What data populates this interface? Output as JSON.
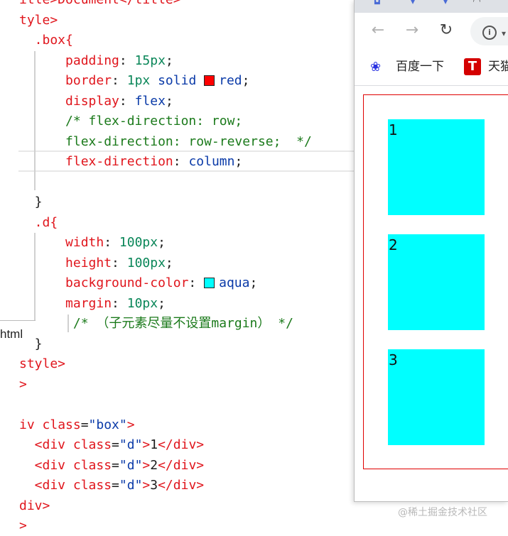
{
  "editor": {
    "lines": [
      {
        "parts": [
          {
            "t": "itle>Document</title>",
            "c": "c-red"
          }
        ]
      },
      {
        "parts": [
          {
            "t": "tyle>",
            "c": "c-red"
          }
        ]
      },
      {
        "parts": [
          {
            "t": "  .box{",
            "c": "c-red"
          }
        ]
      },
      {
        "parts": [
          {
            "t": "      padding",
            "c": "c-red"
          },
          {
            "t": ": ",
            "c": "c-plain"
          },
          {
            "t": "15px",
            "c": "c-num"
          },
          {
            "t": ";",
            "c": "c-plain"
          }
        ]
      },
      {
        "parts": [
          {
            "t": "      border",
            "c": "c-red"
          },
          {
            "t": ": ",
            "c": "c-plain"
          },
          {
            "t": "1px ",
            "c": "c-num"
          },
          {
            "t": "solid ",
            "c": "c-blue"
          },
          {
            "swatch": "#ff0000"
          },
          {
            "t": "red",
            "c": "c-blue"
          },
          {
            "t": ";",
            "c": "c-plain"
          }
        ]
      },
      {
        "parts": [
          {
            "t": "      display",
            "c": "c-red"
          },
          {
            "t": ": ",
            "c": "c-plain"
          },
          {
            "t": "flex",
            "c": "c-blue"
          },
          {
            "t": ";",
            "c": "c-plain"
          }
        ]
      },
      {
        "parts": [
          {
            "t": "      /* flex-direction: row;",
            "c": "c-comment"
          }
        ]
      },
      {
        "parts": [
          {
            "t": "      flex-direction: row-reverse;  */",
            "c": "c-comment"
          }
        ]
      },
      {
        "parts": [
          {
            "t": "      flex-direction",
            "c": "c-red"
          },
          {
            "t": ": ",
            "c": "c-plain"
          },
          {
            "t": "column",
            "c": "c-blue"
          },
          {
            "t": ";",
            "c": "c-plain"
          }
        ]
      },
      {
        "parts": [
          {
            "t": "",
            "c": "c-plain"
          }
        ]
      },
      {
        "parts": [
          {
            "t": "  }",
            "c": "c-plain"
          }
        ]
      },
      {
        "parts": [
          {
            "t": "  .d{",
            "c": "c-red"
          }
        ]
      },
      {
        "parts": [
          {
            "t": "      width",
            "c": "c-red"
          },
          {
            "t": ": ",
            "c": "c-plain"
          },
          {
            "t": "100px",
            "c": "c-num"
          },
          {
            "t": ";",
            "c": "c-plain"
          }
        ]
      },
      {
        "parts": [
          {
            "t": "      height",
            "c": "c-red"
          },
          {
            "t": ": ",
            "c": "c-plain"
          },
          {
            "t": "100px",
            "c": "c-num"
          },
          {
            "t": ";",
            "c": "c-plain"
          }
        ]
      },
      {
        "parts": [
          {
            "t": "      background-color",
            "c": "c-red"
          },
          {
            "t": ": ",
            "c": "c-plain"
          },
          {
            "swatch": "#00ffff"
          },
          {
            "t": "aqua",
            "c": "c-blue"
          },
          {
            "t": ";",
            "c": "c-plain"
          }
        ]
      },
      {
        "parts": [
          {
            "t": "      margin",
            "c": "c-red"
          },
          {
            "t": ": ",
            "c": "c-plain"
          },
          {
            "t": "10px",
            "c": "c-num"
          },
          {
            "t": ";",
            "c": "c-plain"
          }
        ]
      },
      {
        "parts": [
          {
            "t": "       /* （子元素尽量不设置margin） */",
            "c": "c-comment"
          }
        ]
      },
      {
        "parts": [
          {
            "t": "  }",
            "c": "c-plain"
          }
        ]
      },
      {
        "parts": [
          {
            "t": "style>",
            "c": "c-red"
          }
        ]
      },
      {
        "parts": [
          {
            "t": ">",
            "c": "c-red"
          }
        ]
      },
      {
        "parts": [
          {
            "t": "",
            "c": "c-plain"
          }
        ]
      },
      {
        "parts": [
          {
            "t": "iv ",
            "c": "c-red"
          },
          {
            "t": "class",
            "c": "c-red"
          },
          {
            "t": "=",
            "c": "c-plain"
          },
          {
            "t": "\"box\"",
            "c": "c-str"
          },
          {
            "t": ">",
            "c": "c-red"
          }
        ]
      },
      {
        "parts": [
          {
            "t": "  <div ",
            "c": "c-red"
          },
          {
            "t": "class",
            "c": "c-red"
          },
          {
            "t": "=",
            "c": "c-plain"
          },
          {
            "t": "\"d\"",
            "c": "c-str"
          },
          {
            "t": ">",
            "c": "c-red"
          },
          {
            "t": "1",
            "c": "c-plain"
          },
          {
            "t": "</div>",
            "c": "c-red"
          }
        ]
      },
      {
        "parts": [
          {
            "t": "  <div ",
            "c": "c-red"
          },
          {
            "t": "class",
            "c": "c-red"
          },
          {
            "t": "=",
            "c": "c-plain"
          },
          {
            "t": "\"d\"",
            "c": "c-str"
          },
          {
            "t": ">",
            "c": "c-red"
          },
          {
            "t": "2",
            "c": "c-plain"
          },
          {
            "t": "</div>",
            "c": "c-red"
          }
        ]
      },
      {
        "parts": [
          {
            "t": "  <div ",
            "c": "c-red"
          },
          {
            "t": "class",
            "c": "c-red"
          },
          {
            "t": "=",
            "c": "c-plain"
          },
          {
            "t": "\"d\"",
            "c": "c-str"
          },
          {
            "t": ">",
            "c": "c-red"
          },
          {
            "t": "3",
            "c": "c-plain"
          },
          {
            "t": "</div>",
            "c": "c-red"
          }
        ]
      },
      {
        "parts": [
          {
            "t": "div>",
            "c": "c-red"
          }
        ]
      },
      {
        "parts": [
          {
            "t": ">",
            "c": "c-red"
          }
        ]
      }
    ],
    "side_label": "html"
  },
  "browser": {
    "back_icon": "back-arrow-icon",
    "forward_icon": "forward-arrow-icon",
    "reload_icon": "reload-icon",
    "bookmarks": [
      {
        "label": "百度一下",
        "icon": "baidu-paw-icon"
      },
      {
        "label": "天猫",
        "icon": "tmall-icon"
      }
    ],
    "boxes": [
      "1",
      "2",
      "3"
    ],
    "box_color": "#00ffff",
    "border_color": "#ff0000"
  },
  "watermark": "@稀土掘金技术社区"
}
